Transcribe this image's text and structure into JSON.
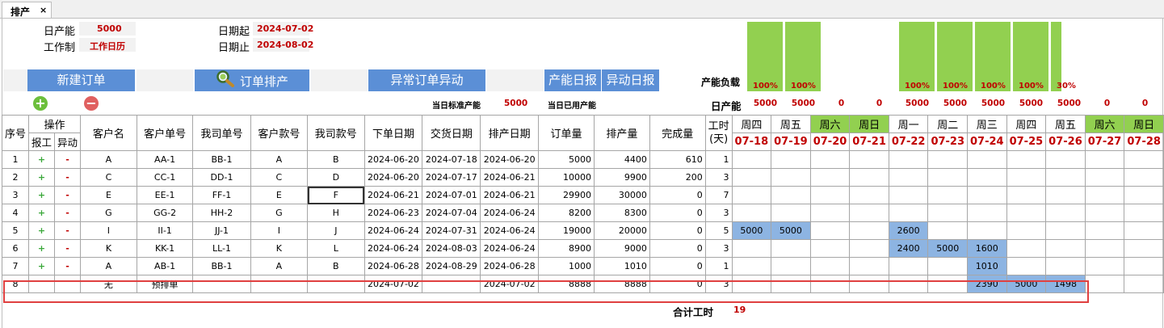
{
  "tab": {
    "title": "排产",
    "close": "×"
  },
  "info": {
    "daily_capacity_label": "日产能",
    "daily_capacity_value": "5000",
    "work_system_label": "工作制",
    "work_system_value": "工作日历",
    "date_start_label": "日期起",
    "date_start_value": "2024-07-02",
    "date_end_label": "日期止",
    "date_end_value": "2024-08-02"
  },
  "buttons": {
    "new_order": "新建订单",
    "schedule_order": "订单排产",
    "abnormal": "异常订单异动",
    "capacity_report": "产能日报",
    "change_report": "异动日报"
  },
  "capacity": {
    "load_label": "产能负载",
    "daily_label": "日产能",
    "std_today_label": "当日标准产能",
    "std_today_value": "5000",
    "used_today_label": "当日已用产能",
    "bars": [
      {
        "pct": "100%",
        "fill": 1.0
      },
      {
        "pct": "100%",
        "fill": 1.0
      },
      {
        "pct": "",
        "fill": 0
      },
      {
        "pct": "",
        "fill": 0
      },
      {
        "pct": "100%",
        "fill": 1.0
      },
      {
        "pct": "100%",
        "fill": 1.0
      },
      {
        "pct": "100%",
        "fill": 1.0
      },
      {
        "pct": "100%",
        "fill": 1.0
      },
      {
        "pct": "30%",
        "fill": 1.0
      },
      {
        "pct": "",
        "fill": 0
      },
      {
        "pct": "",
        "fill": 0
      }
    ],
    "daily_values": [
      "5000",
      "5000",
      "0",
      "0",
      "5000",
      "5000",
      "5000",
      "5000",
      "5000",
      "0",
      "0"
    ]
  },
  "table": {
    "headers": {
      "seq": "序号",
      "ops": "操作",
      "report": "报工",
      "change": "异动",
      "customer": "客户名",
      "cust_order": "客户单号",
      "our_order": "我司单号",
      "cust_style": "客户款号",
      "our_style": "我司款号",
      "order_date": "下单日期",
      "delivery_date": "交货日期",
      "schedule_date": "排产日期",
      "order_qty": "订单量",
      "schedule_qty": "排产量",
      "done_qty": "完成量",
      "work_hours": "工时(天)"
    },
    "weekdays": [
      "周四",
      "周五",
      "周六",
      "周日",
      "周一",
      "周二",
      "周三",
      "周四",
      "周五",
      "周六",
      "周日"
    ],
    "dates": [
      "07-18",
      "07-19",
      "07-20",
      "07-21",
      "07-22",
      "07-23",
      "07-24",
      "07-25",
      "07-26",
      "07-27",
      "07-28"
    ],
    "rows": [
      {
        "seq": "1",
        "plus": "+",
        "minus": "-",
        "customer": "A",
        "cust_order": "AA-1",
        "our_order": "BB-1",
        "cust_style": "A",
        "our_style": "B",
        "order_date": "2024-06-20",
        "delivery_date": "2024-07-18",
        "schedule_date": "2024-06-20",
        "order_qty": "5000",
        "schedule_qty": "4400",
        "done_qty": "610",
        "hours": "1",
        "days": [
          "",
          "",
          "",
          "",
          "",
          "",
          "",
          "",
          "",
          "",
          ""
        ]
      },
      {
        "seq": "2",
        "plus": "+",
        "minus": "-",
        "customer": "C",
        "cust_order": "CC-1",
        "our_order": "DD-1",
        "cust_style": "C",
        "our_style": "D",
        "order_date": "2024-06-20",
        "delivery_date": "2024-07-17",
        "schedule_date": "2024-06-21",
        "order_qty": "10000",
        "schedule_qty": "9900",
        "done_qty": "200",
        "hours": "3",
        "days": [
          "",
          "",
          "",
          "",
          "",
          "",
          "",
          "",
          "",
          "",
          ""
        ]
      },
      {
        "seq": "3",
        "plus": "+",
        "minus": "-",
        "customer": "E",
        "cust_order": "EE-1",
        "our_order": "FF-1",
        "cust_style": "E",
        "our_style": "F",
        "order_date": "2024-06-21",
        "delivery_date": "2024-07-01",
        "schedule_date": "2024-06-21",
        "order_qty": "29900",
        "schedule_qty": "30000",
        "done_qty": "0",
        "hours": "7",
        "days": [
          "",
          "",
          "",
          "",
          "",
          "",
          "",
          "",
          "",
          "",
          ""
        ]
      },
      {
        "seq": "4",
        "plus": "+",
        "minus": "-",
        "customer": "G",
        "cust_order": "GG-2",
        "our_order": "HH-2",
        "cust_style": "G",
        "our_style": "H",
        "order_date": "2024-06-23",
        "delivery_date": "2024-07-04",
        "schedule_date": "2024-06-24",
        "order_qty": "8200",
        "schedule_qty": "8300",
        "done_qty": "0",
        "hours": "3",
        "days": [
          "",
          "",
          "",
          "",
          "",
          "",
          "",
          "",
          "",
          "",
          ""
        ]
      },
      {
        "seq": "5",
        "plus": "+",
        "minus": "-",
        "customer": "I",
        "cust_order": "II-1",
        "our_order": "JJ-1",
        "cust_style": "I",
        "our_style": "J",
        "order_date": "2024-06-24",
        "delivery_date": "2024-07-31",
        "schedule_date": "2024-06-24",
        "order_qty": "19000",
        "schedule_qty": "20000",
        "done_qty": "0",
        "hours": "5",
        "days": [
          "5000",
          "5000",
          "",
          "",
          "2600",
          "",
          "",
          "",
          "",
          "",
          ""
        ]
      },
      {
        "seq": "6",
        "plus": "+",
        "minus": "-",
        "customer": "K",
        "cust_order": "KK-1",
        "our_order": "LL-1",
        "cust_style": "K",
        "our_style": "L",
        "order_date": "2024-06-24",
        "delivery_date": "2024-08-03",
        "schedule_date": "2024-06-24",
        "order_qty": "8900",
        "schedule_qty": "9000",
        "done_qty": "0",
        "hours": "3",
        "days": [
          "",
          "",
          "",
          "",
          "2400",
          "5000",
          "1600",
          "",
          "",
          "",
          ""
        ]
      },
      {
        "seq": "7",
        "plus": "+",
        "minus": "-",
        "customer": "A",
        "cust_order": "AB-1",
        "our_order": "BB-1",
        "cust_style": "A",
        "our_style": "B",
        "order_date": "2024-06-28",
        "delivery_date": "2024-08-29",
        "schedule_date": "2024-06-28",
        "order_qty": "1000",
        "schedule_qty": "1010",
        "done_qty": "0",
        "hours": "1",
        "days": [
          "",
          "",
          "",
          "",
          "",
          "",
          "1010",
          "",
          "",
          "",
          ""
        ]
      },
      {
        "seq": "8",
        "plus": "",
        "minus": "",
        "customer": "无",
        "cust_order": "预排单",
        "our_order": "",
        "cust_style": "",
        "our_style": "",
        "order_date": "2024-07-02",
        "delivery_date": "",
        "schedule_date": "2024-07-02",
        "order_qty": "8888",
        "schedule_qty": "8888",
        "done_qty": "0",
        "hours": "3",
        "days": [
          "",
          "",
          "",
          "",
          "",
          "",
          "2390",
          "5000",
          "1498",
          "",
          ""
        ]
      }
    ],
    "total_hours_label": "合计工时",
    "total_hours_value": "19"
  }
}
